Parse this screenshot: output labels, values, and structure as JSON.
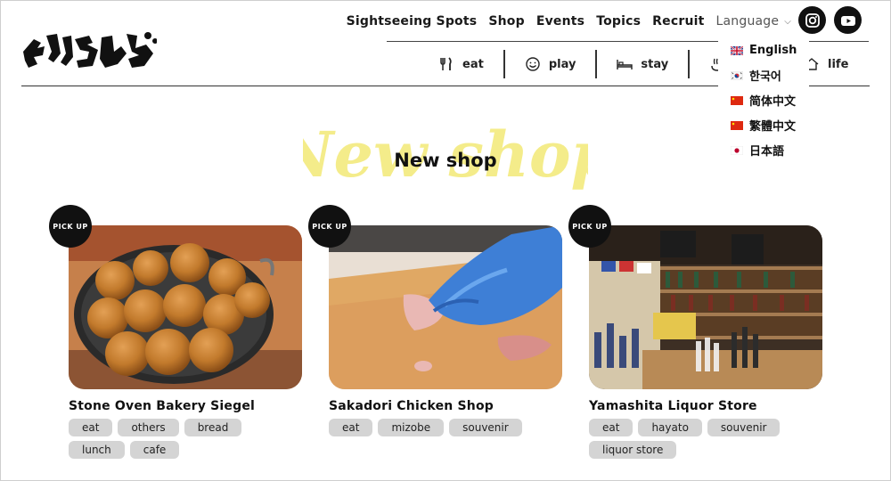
{
  "logo": {
    "alt_text": "きりなび"
  },
  "nav": {
    "links": [
      "Sightseeing Spots",
      "Shop",
      "Events",
      "Topics",
      "Recruit"
    ],
    "language_label": "Language"
  },
  "social": {
    "instagram_icon": "instagram-icon",
    "youtube_icon": "youtube-icon"
  },
  "categories": [
    {
      "label": "eat",
      "icon": "fork-knife-icon"
    },
    {
      "label": "play",
      "icon": "smile-icon"
    },
    {
      "label": "stay",
      "icon": "bed-icon"
    },
    {
      "label": "life",
      "icon": "house-icon"
    }
  ],
  "language_menu": [
    {
      "label": "English",
      "flag": "uk-flag-icon"
    },
    {
      "label": "한국어",
      "flag": "korea-flag-icon"
    },
    {
      "label": "简体中文",
      "flag": "china-flag-icon"
    },
    {
      "label": "繁體中文",
      "flag": "china-flag-icon"
    },
    {
      "label": "日本語",
      "flag": "japan-flag-icon"
    }
  ],
  "section": {
    "heading": "New shop",
    "script_text": "New shop"
  },
  "badge_text": "PICK UP",
  "cards": [
    {
      "name": "Stone Oven Bakery Siegel",
      "tags": [
        "eat",
        "others",
        "bread",
        "lunch",
        "cafe"
      ]
    },
    {
      "name": "Sakadori Chicken Shop",
      "tags": [
        "eat",
        "mizobe",
        "souvenir"
      ]
    },
    {
      "name": "Yamashita Liquor Store",
      "tags": [
        "eat",
        "hayato",
        "souvenir",
        "liquor store"
      ]
    }
  ],
  "colors": {
    "script_yellow": "#f4ec8a",
    "tag_bg": "#d4d4d4",
    "text": "#111111"
  }
}
